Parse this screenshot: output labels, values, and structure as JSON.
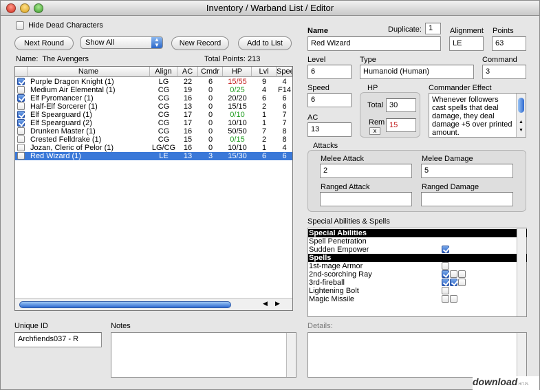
{
  "window": {
    "title": "Inventory / Warband List / Editor"
  },
  "left": {
    "hide_dead": {
      "label": "Hide Dead Characters",
      "checked": false
    },
    "next_round": "Next Round",
    "filter": {
      "selected": "Show All"
    },
    "new_record": "New Record",
    "add_to_list": "Add to List",
    "name_label": "Name:",
    "name_value": "The Avengers",
    "total_label": "Total Points:",
    "total_value": "213",
    "columns": [
      "Name",
      "Align",
      "AC",
      "Cmdr",
      "HP",
      "Lvl",
      "Speed"
    ],
    "rows": [
      {
        "checked": true,
        "name": "Purple Dragon Knight (1)",
        "align": "LG",
        "ac": "22",
        "cmdr": "6",
        "hp": "15/55",
        "hp_color": "red",
        "lvl": "9",
        "speed": "4"
      },
      {
        "checked": false,
        "name": "Medium Air Elemental (1)",
        "align": "CG",
        "ac": "19",
        "cmdr": "0",
        "hp": "0/25",
        "hp_color": "green",
        "lvl": "4",
        "speed": "F14"
      },
      {
        "checked": true,
        "name": "Elf Pyromancer (1)",
        "align": "CG",
        "ac": "16",
        "cmdr": "0",
        "hp": "20/20",
        "hp_color": "black",
        "lvl": "6",
        "speed": "6"
      },
      {
        "checked": false,
        "name": "Half-Elf Sorcerer (1)",
        "align": "CG",
        "ac": "13",
        "cmdr": "0",
        "hp": "15/15",
        "hp_color": "black",
        "lvl": "2",
        "speed": "6"
      },
      {
        "checked": true,
        "name": "Elf Spearguard (1)",
        "align": "CG",
        "ac": "17",
        "cmdr": "0",
        "hp": "0/10",
        "hp_color": "green",
        "lvl": "1",
        "speed": "7"
      },
      {
        "checked": true,
        "name": "Elf Spearguard (2)",
        "align": "CG",
        "ac": "17",
        "cmdr": "0",
        "hp": "10/10",
        "hp_color": "black",
        "lvl": "1",
        "speed": "7"
      },
      {
        "checked": false,
        "name": "Drunken Master (1)",
        "align": "CG",
        "ac": "16",
        "cmdr": "0",
        "hp": "50/50",
        "hp_color": "black",
        "lvl": "7",
        "speed": "8"
      },
      {
        "checked": false,
        "name": "Crested Felldrake (1)",
        "align": "CG",
        "ac": "15",
        "cmdr": "0",
        "hp": "0/15",
        "hp_color": "green",
        "lvl": "2",
        "speed": "8"
      },
      {
        "checked": false,
        "name": "Jozan, Cleric of Pelor (1)",
        "align": "LG/CG",
        "ac": "16",
        "cmdr": "0",
        "hp": "10/10",
        "hp_color": "black",
        "lvl": "1",
        "speed": "4"
      },
      {
        "checked": false,
        "name": "Red Wizard (1)",
        "align": "LE",
        "ac": "13",
        "cmdr": "3",
        "hp": "15/30",
        "hp_color": "white",
        "lvl": "6",
        "speed": "6",
        "selected": true
      }
    ],
    "unique_id_label": "Unique ID",
    "unique_id_value": "Archfiends037 - R",
    "notes_label": "Notes"
  },
  "editor": {
    "name_label": "Name",
    "name_value": "Red Wizard",
    "duplicate_label": "Duplicate:",
    "duplicate_value": "1",
    "alignment_label": "Alignment",
    "alignment_value": "LE",
    "points_label": "Points",
    "points_value": "63",
    "level_label": "Level",
    "level_value": "6",
    "type_label": "Type",
    "type_value": "Humanoid (Human)",
    "command_label": "Command",
    "command_value": "3",
    "speed_label": "Speed",
    "speed_value": "6",
    "hp_label": "HP",
    "total_label": "Total",
    "total_value": "30",
    "rem_label": "Rem",
    "rem_value": "15",
    "rem_button": "x",
    "commander_effect_label": "Commander Effect",
    "commander_effect_text": "Whenever followers cast spells that deal damage, they deal damage +5 over printed amount.",
    "ac_label": "AC",
    "ac_value": "13",
    "attacks_label": "Attacks",
    "melee_attack_label": "Melee Attack",
    "melee_attack_value": "2",
    "melee_damage_label": "Melee Damage",
    "melee_damage_value": "5",
    "ranged_attack_label": "Ranged Attack",
    "ranged_attack_value": "",
    "ranged_damage_label": "Ranged Damage",
    "ranged_damage_value": "",
    "sa_label": "Special Abilities & Spells",
    "sa_rows": [
      {
        "type": "header",
        "text": "Special Abilities"
      },
      {
        "type": "item",
        "text": "Spell Penetration",
        "boxes": []
      },
      {
        "type": "item",
        "text": "Sudden Empower",
        "boxes": [
          true
        ]
      },
      {
        "type": "header",
        "text": "Spells"
      },
      {
        "type": "item",
        "text": "1st-mage Armor",
        "boxes": [
          false
        ]
      },
      {
        "type": "item",
        "text": "2nd-scorching Ray",
        "boxes": [
          true,
          false,
          false
        ]
      },
      {
        "type": "item",
        "text": "3rd-fireball",
        "boxes": [
          true,
          true,
          false
        ]
      },
      {
        "type": "item",
        "text": "Lightening Bolt",
        "boxes": [
          false
        ]
      },
      {
        "type": "item",
        "text": "Magic Missile",
        "boxes": [
          false,
          false
        ]
      }
    ],
    "details_label": "Details:"
  },
  "watermark": {
    "text": "download",
    "suffix": ".HIT.PL"
  }
}
